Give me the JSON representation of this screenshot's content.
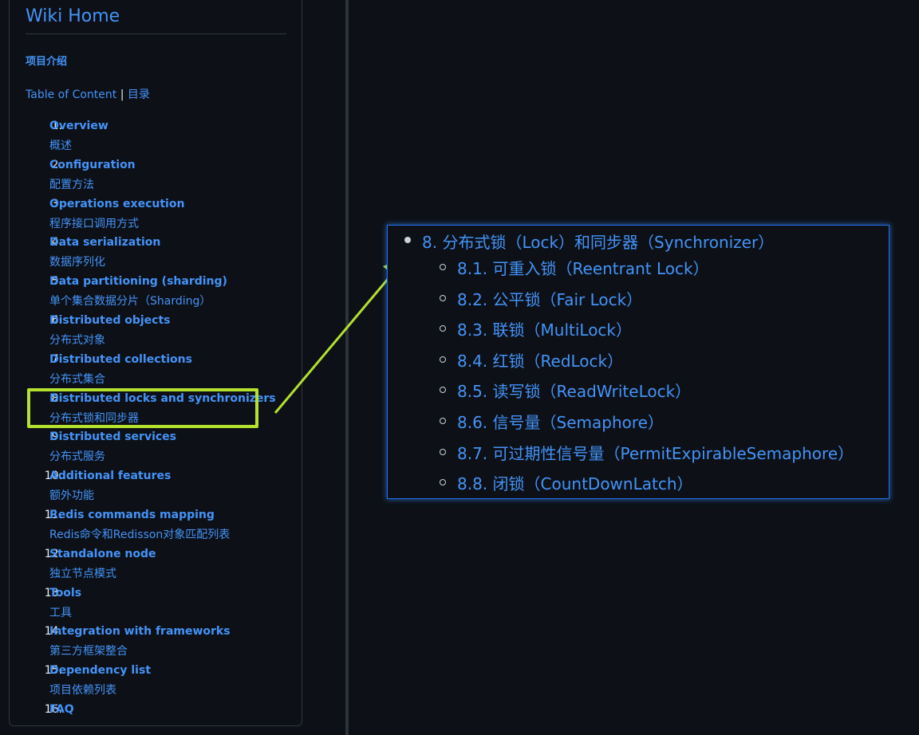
{
  "sidebar": {
    "title": "Wiki Home",
    "intro": "项目介绍",
    "toc_link": "Table of Content",
    "toc_sep": "|",
    "toc_cn": "目录",
    "items": [
      {
        "num": "1.",
        "en": "Overview",
        "zh": "概述"
      },
      {
        "num": "2.",
        "en": "Configuration",
        "zh": "配置方法"
      },
      {
        "num": "3.",
        "en": "Operations execution",
        "zh": "程序接口调用方式"
      },
      {
        "num": "4.",
        "en": "Data serialization",
        "zh": "数据序列化"
      },
      {
        "num": "5.",
        "en": "Data partitioning (sharding)",
        "zh": "单个集合数据分片（Sharding）"
      },
      {
        "num": "6.",
        "en": "Distributed objects",
        "zh": "分布式对象"
      },
      {
        "num": "7.",
        "en": "Distributed collections",
        "zh": "分布式集合"
      },
      {
        "num": "8.",
        "en": "Distributed locks and synchronizers",
        "zh": "分布式锁和同步器"
      },
      {
        "num": "9.",
        "en": "Distributed services",
        "zh": "分布式服务"
      },
      {
        "num": "10.",
        "en": "Additional features",
        "zh": "额外功能"
      },
      {
        "num": "11.",
        "en": "Redis commands mapping",
        "zh": "Redis命令和Redisson对象匹配列表"
      },
      {
        "num": "12.",
        "en": "Standalone node",
        "zh": "独立节点模式"
      },
      {
        "num": "13.",
        "en": "Tools",
        "zh": "工具"
      },
      {
        "num": "14.",
        "en": "Integration with frameworks",
        "zh": "第三方框架整合"
      },
      {
        "num": "15.",
        "en": "Dependency list",
        "zh": "项目依赖列表"
      },
      {
        "num": "16.",
        "en": "FAQ",
        "zh": ""
      }
    ]
  },
  "zoom": {
    "main": "8. 分布式锁（Lock）和同步器（Synchronizer）",
    "subs": [
      "8.1. 可重入锁（Reentrant Lock）",
      "8.2. 公平锁（Fair Lock）",
      "8.3. 联锁（MultiLock）",
      "8.4. 红锁（RedLock）",
      "8.5. 读写锁（ReadWriteLock）",
      "8.6. 信号量（Semaphore）",
      "8.7. 可过期性信号量（PermitExpirableSemaphore）",
      "8.8. 闭锁（CountDownLatch）"
    ]
  },
  "colors": {
    "background": "#0d1117",
    "link": "#4493f8",
    "highlight": "#b4e12e",
    "panel_border": "#1f6feb"
  }
}
